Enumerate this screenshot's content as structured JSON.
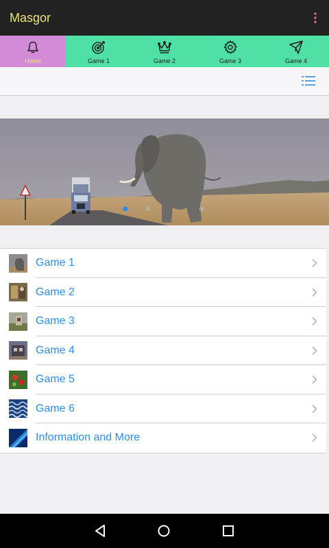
{
  "app": {
    "title": "Masgor"
  },
  "tabs": [
    {
      "label": "Home",
      "icon": "bell-icon",
      "active": true
    },
    {
      "label": "Game 1",
      "icon": "target-icon",
      "active": false
    },
    {
      "label": "Game 2",
      "icon": "crown-icon",
      "active": false
    },
    {
      "label": "Game 3",
      "icon": "gear-icon",
      "active": false
    },
    {
      "label": "Game 4",
      "icon": "paper-plane-icon",
      "active": false
    }
  ],
  "colors": {
    "appbar": "#222222",
    "title": "#e9e27a",
    "tab_bg": "#4fe0a5",
    "tab_active_bg": "#d38ad7",
    "link_blue": "#2a8ee8"
  },
  "banner": {
    "slides": 3,
    "active_slide": 1,
    "image": "elephant-on-road-photo"
  },
  "list": {
    "items": [
      {
        "label": "Game 1",
        "thumb": "game-1-thumbnail"
      },
      {
        "label": "Game 2",
        "thumb": "game-2-thumbnail"
      },
      {
        "label": "Game 3",
        "thumb": "game-3-thumbnail"
      },
      {
        "label": "Game 4",
        "thumb": "game-4-thumbnail"
      },
      {
        "label": "Game 5",
        "thumb": "game-5-thumbnail"
      },
      {
        "label": "Game 6",
        "thumb": "game-6-thumbnail"
      },
      {
        "label": "Information and More",
        "thumb": "info-thumbnail"
      }
    ]
  },
  "navbar": {
    "buttons": [
      "back-icon",
      "home-icon",
      "recents-icon"
    ]
  }
}
